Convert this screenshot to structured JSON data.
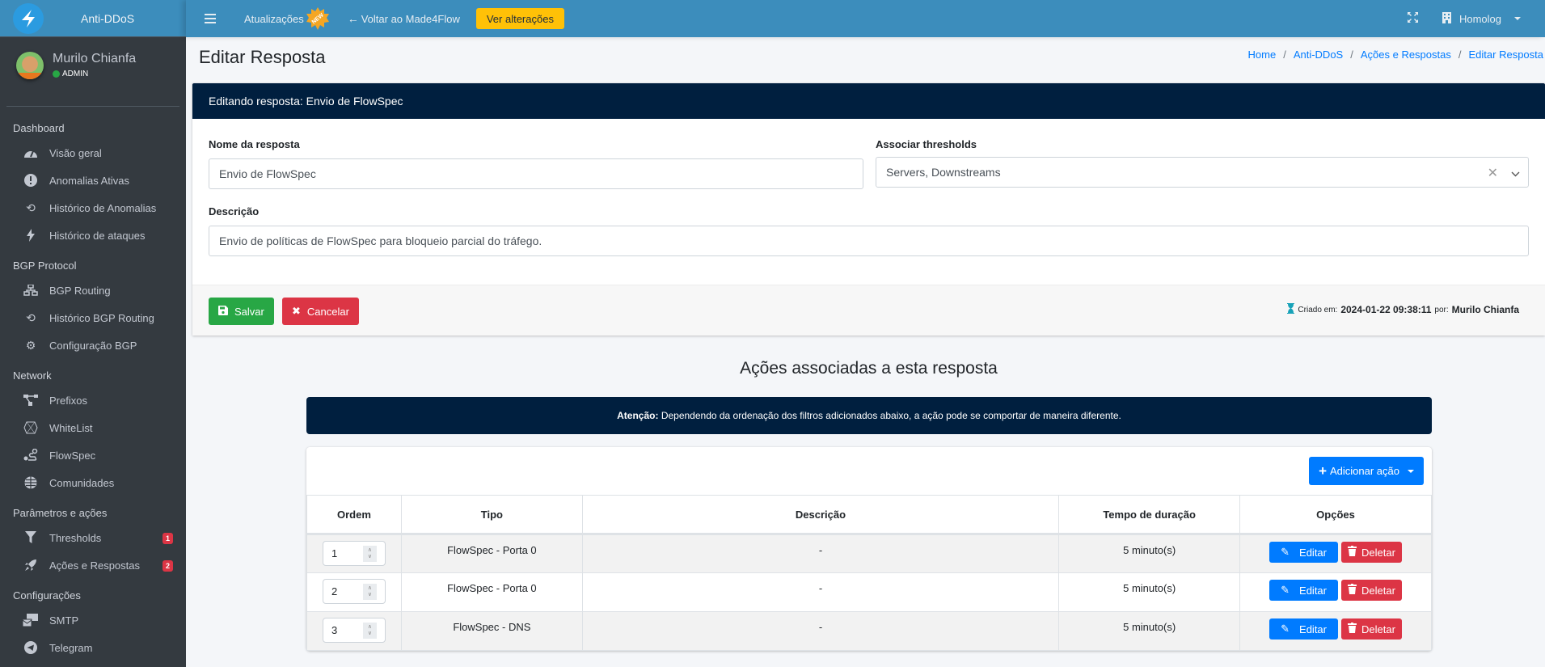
{
  "app": {
    "brand": "Anti-DDoS"
  },
  "user": {
    "name": "Murilo Chianfa",
    "role": "ADMIN"
  },
  "topbar": {
    "updates_label": "Atualizações",
    "new_badge": "NEW",
    "back_label": "Voltar ao Made4Flow",
    "see_changes_label": "Ver alterações",
    "environment": "Homolog"
  },
  "sidebar": {
    "sections": [
      {
        "header": "Dashboard",
        "items": [
          {
            "label": "Visão geral",
            "icon": "tachometer-icon"
          },
          {
            "label": "Anomalias Ativas",
            "icon": "exclamation-circle-icon"
          },
          {
            "label": "Histórico de Anomalias",
            "icon": "history-icon"
          },
          {
            "label": "Histórico de ataques",
            "icon": "bolt-icon"
          }
        ]
      },
      {
        "header": "BGP Protocol",
        "items": [
          {
            "label": "BGP Routing",
            "icon": "sitemap-icon"
          },
          {
            "label": "Histórico BGP Routing",
            "icon": "history-icon"
          },
          {
            "label": "Configuração BGP",
            "icon": "cog-icon"
          }
        ]
      },
      {
        "header": "Network",
        "items": [
          {
            "label": "Prefixos",
            "icon": "project-diagram-icon"
          },
          {
            "label": "WhiteList",
            "icon": "hexagon-icon"
          },
          {
            "label": "FlowSpec",
            "icon": "route-icon"
          },
          {
            "label": "Comunidades",
            "icon": "globe-icon"
          }
        ]
      },
      {
        "header": "Parâmetros e ações",
        "items": [
          {
            "label": "Thresholds",
            "icon": "filter-icon",
            "badge": "1"
          },
          {
            "label": "Ações e Respostas",
            "icon": "rocket-icon",
            "badge": "2"
          }
        ]
      },
      {
        "header": "Configurações",
        "items": [
          {
            "label": "SMTP",
            "icon": "mail-bulk-icon"
          },
          {
            "label": "Telegram",
            "icon": "telegram-icon"
          }
        ]
      }
    ]
  },
  "page": {
    "title": "Editar Resposta",
    "breadcrumb": [
      "Home",
      "Anti-DDoS",
      "Ações e Respostas",
      "Editar Resposta"
    ]
  },
  "form": {
    "header": "Editando resposta: Envio de FlowSpec",
    "name_label": "Nome da resposta",
    "name_value": "Envio de FlowSpec",
    "thresholds_label": "Associar thresholds",
    "thresholds_value": "Servers, Downstreams",
    "description_label": "Descrição",
    "description_value": "Envio de políticas de FlowSpec para bloqueio parcial do tráfego.",
    "save_label": "Salvar",
    "cancel_label": "Cancelar",
    "created_prefix": "Criado em:",
    "created_at": "2024-01-22 09:38:11",
    "created_by_prefix": "por:",
    "created_by": "Murilo Chianfa"
  },
  "actions": {
    "title": "Ações associadas a esta resposta",
    "alert_strong": "Atenção:",
    "alert_text": "Dependendo da ordenação dos filtros adicionados abaixo, a ação pode se comportar de maneira diferente.",
    "add_label": "Adicionar ação",
    "columns": [
      "Ordem",
      "Tipo",
      "Descrição",
      "Tempo de duração",
      "Opções"
    ],
    "rows": [
      {
        "order": "1",
        "type": "FlowSpec - Porta 0",
        "description": "-",
        "duration": "5 minuto(s)"
      },
      {
        "order": "2",
        "type": "FlowSpec - Porta 0",
        "description": "-",
        "duration": "5 minuto(s)"
      },
      {
        "order": "3",
        "type": "FlowSpec - DNS",
        "description": "-",
        "duration": "5 minuto(s)"
      }
    ],
    "edit_label": "Editar",
    "delete_label": "Deletar"
  }
}
